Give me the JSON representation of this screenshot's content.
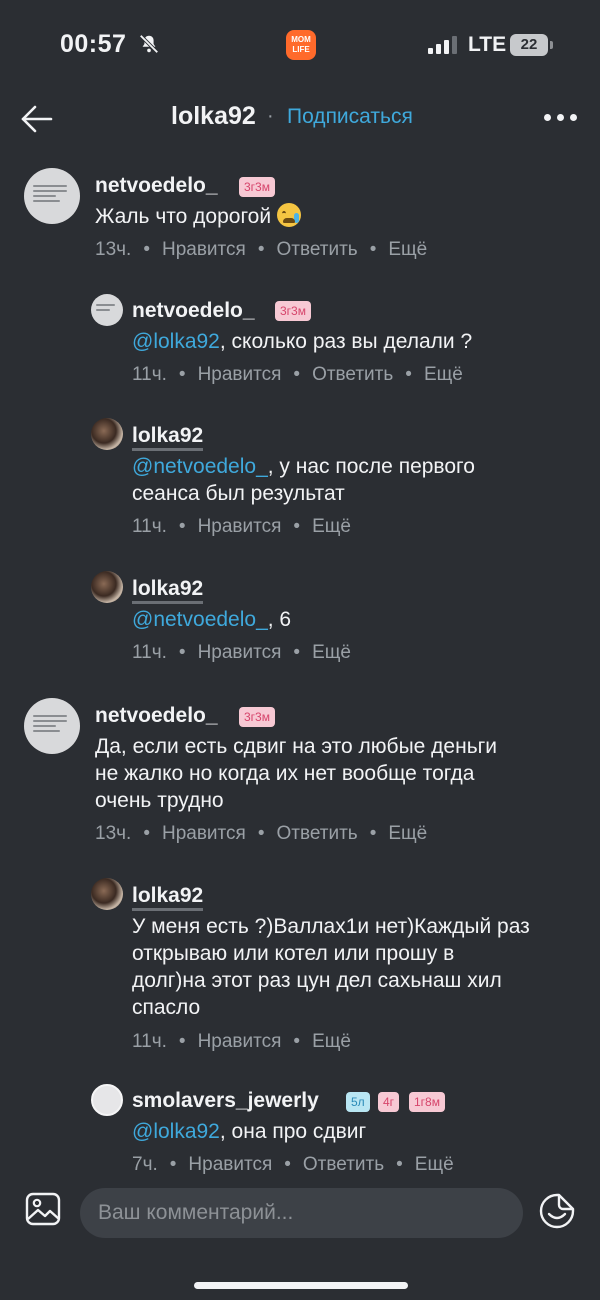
{
  "status_bar": {
    "time": "00:57",
    "app_logo_text": "MOM LIFE",
    "network": "LTE",
    "battery": "22",
    "icons": [
      "bell-slash-icon",
      "signal-icon",
      "battery-icon"
    ]
  },
  "header": {
    "title": "lolka92",
    "separator": "·",
    "subscribe_label": "Подписаться",
    "icons": [
      "arrow-left-icon",
      "more-dots-icon"
    ]
  },
  "comments": [
    {
      "username": "netvoedelo_",
      "badges": [
        "3г3м"
      ],
      "text": "Жаль что дорогой",
      "emoji": "crying-face-icon",
      "time": "13ч.",
      "actions": [
        "Нравится",
        "Ответить",
        "Ещё"
      ]
    },
    {
      "username": "netvoedelo_",
      "badges": [
        "3г3м"
      ],
      "mention": "@lolka92",
      "text": ", сколько раз вы делали ?",
      "time": "11ч.",
      "actions": [
        "Нравится",
        "Ответить",
        "Ещё"
      ]
    },
    {
      "username": "lolka92",
      "mention": "@netvoedelo_",
      "text_line1": ", у нас после первого",
      "text_line2": "сеанса был результат",
      "time": "11ч.",
      "actions": [
        "Нравится",
        "Ещё"
      ]
    },
    {
      "username": "lolka92",
      "mention": "@netvoedelo_",
      "text": ", 6",
      "time": "11ч.",
      "actions": [
        "Нравится",
        "Ещё"
      ]
    },
    {
      "username": "netvoedelo_",
      "badges": [
        "3г3м"
      ],
      "text_lines": [
        "Да, если есть сдвиг на это любые деньги",
        "не жалко но когда их нет вообще тогда",
        "очень трудно"
      ],
      "time": "13ч.",
      "actions": [
        "Нравится",
        "Ответить",
        "Ещё"
      ]
    },
    {
      "username": "lolka92",
      "text_lines": [
        "У меня есть ?)Валлах1и нет)Каждый раз",
        "открываю или котел или прошу в",
        "долг)на этот раз цун дел сахьнаш хил",
        "спасло"
      ],
      "time": "11ч.",
      "actions": [
        "Нравится",
        "Ещё"
      ]
    },
    {
      "username": "smolavers_jewerly",
      "badges": [
        "5л",
        "4г",
        "1г8м"
      ],
      "mention": "@lolka92",
      "text": ", она про сдвиг",
      "time": "7ч.",
      "actions": [
        "Нравится",
        "Ответить",
        "Ещё"
      ]
    }
  ],
  "composer": {
    "placeholder": "Ваш комментарий...",
    "icons": [
      "image-icon",
      "sticker-icon"
    ]
  },
  "colors": {
    "background": "#2b2e33",
    "accent": "#3fa9dc",
    "muted": "#9aa0a6",
    "badge_pink": "#f7c9d4",
    "badge_blue": "#b9e6f3"
  }
}
